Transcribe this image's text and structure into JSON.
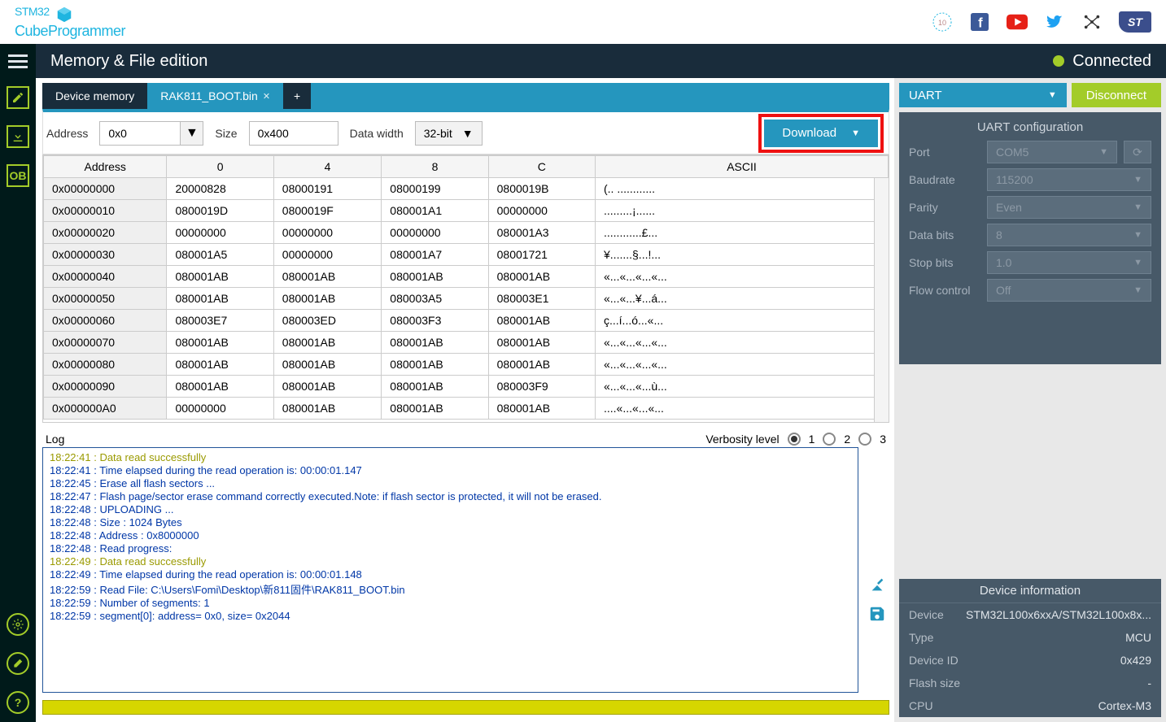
{
  "app_name_l1": "STM32",
  "app_name_l2": "CubeProgrammer",
  "title": "Memory & File edition",
  "status": "Connected",
  "sidebar": {
    "ob": "OB"
  },
  "tabs": [
    {
      "label": "Device memory"
    },
    {
      "label": "RAK811_BOOT.bin"
    }
  ],
  "toolbar": {
    "addr_label": "Address",
    "addr_value": "0x0",
    "size_label": "Size",
    "size_value": "0x400",
    "dw_label": "Data width",
    "dw_value": "32-bit",
    "download": "Download"
  },
  "headers": [
    "Address",
    "0",
    "4",
    "8",
    "C",
    "ASCII"
  ],
  "rows": [
    [
      "0x00000000",
      "20000828",
      "08000191",
      "08000199",
      "0800019B",
      "(..  ............"
    ],
    [
      "0x00000010",
      "0800019D",
      "0800019F",
      "080001A1",
      "00000000",
      ".........¡......"
    ],
    [
      "0x00000020",
      "00000000",
      "00000000",
      "00000000",
      "080001A3",
      "............£..."
    ],
    [
      "0x00000030",
      "080001A5",
      "00000000",
      "080001A7",
      "08001721",
      "¥.......§...!..."
    ],
    [
      "0x00000040",
      "080001AB",
      "080001AB",
      "080001AB",
      "080001AB",
      "«...«...«...«..."
    ],
    [
      "0x00000050",
      "080001AB",
      "080001AB",
      "080003A5",
      "080003E1",
      "«...«...¥...á..."
    ],
    [
      "0x00000060",
      "080003E7",
      "080003ED",
      "080003F3",
      "080001AB",
      "ç...í...ó...«..."
    ],
    [
      "0x00000070",
      "080001AB",
      "080001AB",
      "080001AB",
      "080001AB",
      "«...«...«...«..."
    ],
    [
      "0x00000080",
      "080001AB",
      "080001AB",
      "080001AB",
      "080001AB",
      "«...«...«...«..."
    ],
    [
      "0x00000090",
      "080001AB",
      "080001AB",
      "080001AB",
      "080003F9",
      "«...«...«...ù..."
    ],
    [
      "0x000000A0",
      "00000000",
      "080001AB",
      "080001AB",
      "080001AB",
      "....«...«...«..."
    ]
  ],
  "log": {
    "title": "Log",
    "verbosity": "Verbosity level",
    "levels": [
      "1",
      "2",
      "3"
    ],
    "lines": [
      {
        "t": "18:22:41 : Data read successfully",
        "c": "yy"
      },
      {
        "t": "18:22:41 : Time elapsed during the read operation is: 00:00:01.147"
      },
      {
        "t": "18:22:45 : Erase all flash sectors ..."
      },
      {
        "t": "18:22:47 : Flash page/sector erase command correctly executed.Note: if flash sector is protected, it will not be erased."
      },
      {
        "t": "18:22:48 : UPLOADING ..."
      },
      {
        "t": "18:22:48 : Size : 1024 Bytes"
      },
      {
        "t": "18:22:48 : Address : 0x8000000"
      },
      {
        "t": "18:22:48 : Read progress:"
      },
      {
        "t": "18:22:49 : Data read successfully",
        "c": "yy"
      },
      {
        "t": "18:22:49 : Time elapsed during the read operation is: 00:00:01.148"
      },
      {
        "t": "18:22:59 : Read File: C:\\Users\\Fomi\\Desktop\\新811固件\\RAK811_BOOT.bin"
      },
      {
        "t": "18:22:59 : Number of segments: 1"
      },
      {
        "t": "18:22:59 : segment[0]: address= 0x0, size= 0x2044"
      }
    ]
  },
  "conn": {
    "iface": "UART",
    "disconnect": "Disconnect",
    "conf_title": "UART configuration",
    "port_l": "Port",
    "port_v": "COM5",
    "baud_l": "Baudrate",
    "baud_v": "115200",
    "par_l": "Parity",
    "par_v": "Even",
    "db_l": "Data bits",
    "db_v": "8",
    "sb_l": "Stop bits",
    "sb_v": "1.0",
    "fc_l": "Flow control",
    "fc_v": "Off"
  },
  "devinfo": {
    "title": "Device information",
    "device_l": "Device",
    "device_v": "STM32L100x6xxA/STM32L100x8x...",
    "type_l": "Type",
    "type_v": "MCU",
    "id_l": "Device ID",
    "id_v": "0x429",
    "flash_l": "Flash size",
    "flash_v": "-",
    "cpu_l": "CPU",
    "cpu_v": "Cortex-M3"
  }
}
